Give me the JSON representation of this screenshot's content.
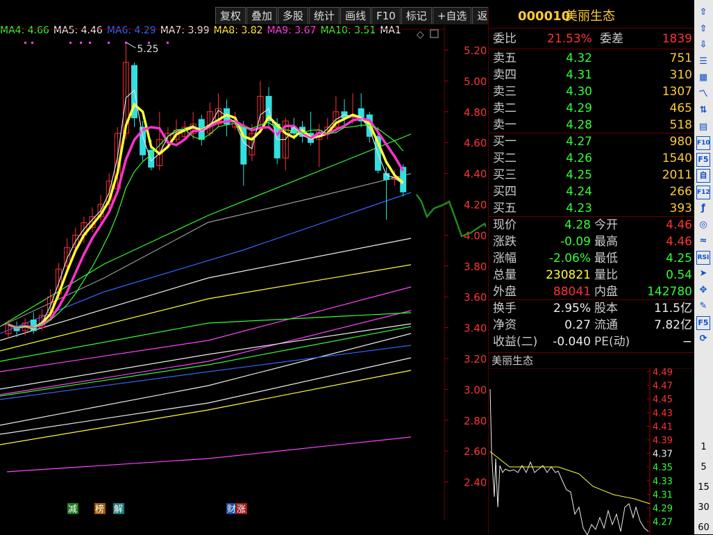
{
  "toolbar": {
    "items": [
      "复权",
      "叠加",
      "多股",
      "统计",
      "画线",
      "F10",
      "标记",
      "+自选",
      "返回"
    ]
  },
  "stock": {
    "code": "000010",
    "name": "美丽生态"
  },
  "ma_legend": [
    {
      "label": "MA4: 4.66",
      "color": "#33ff33"
    },
    {
      "label": "MA5: 4.46",
      "color": "#eeeeee"
    },
    {
      "label": "MA6: 4.29",
      "color": "#3366ff"
    },
    {
      "label": "MA7: 3.99",
      "color": "#eeeeee"
    },
    {
      "label": "MA8: 3.82",
      "color": "#ffff33"
    },
    {
      "label": "MA9: 3.67",
      "color": "#ff44ff"
    },
    {
      "label": "MA10: 3.51",
      "color": "#33ff33"
    },
    {
      "label": "MA1",
      "color": "#eeeeee"
    }
  ],
  "chart_data": {
    "type": "candlestick",
    "ylim": [
      2.3,
      5.3
    ],
    "y_ticks": [
      "5.20",
      "5.00",
      "4.80",
      "4.60",
      "4.40",
      "4.20",
      "4.00",
      "3.80",
      "3.60",
      "3.40",
      "3.20",
      "3.00",
      "2.80",
      "2.60",
      "2.40"
    ],
    "high_annotation": "5.25",
    "markers": [
      {
        "text": "减",
        "bg": "#1b7a1b"
      },
      {
        "text": "榜",
        "bg": "#a05a00"
      },
      {
        "text": "解",
        "bg": "#1b7a7a"
      },
      {
        "text": "财",
        "bg": "#1b4a9a"
      },
      {
        "text": "涨",
        "bg": "#a01b1b"
      }
    ],
    "candles": [
      {
        "o": 3.36,
        "c": 3.42,
        "h": 3.45,
        "l": 3.33
      },
      {
        "o": 3.4,
        "c": 3.38,
        "h": 3.44,
        "l": 3.34
      },
      {
        "o": 3.38,
        "c": 3.43,
        "h": 3.46,
        "l": 3.35
      },
      {
        "o": 3.45,
        "c": 3.38,
        "h": 3.5,
        "l": 3.36
      },
      {
        "o": 3.4,
        "c": 3.48,
        "h": 3.52,
        "l": 3.38
      },
      {
        "o": 3.5,
        "c": 3.6,
        "h": 3.65,
        "l": 3.46
      },
      {
        "o": 3.62,
        "c": 3.78,
        "h": 3.82,
        "l": 3.58
      },
      {
        "o": 3.8,
        "c": 3.92,
        "h": 3.98,
        "l": 3.75
      },
      {
        "o": 3.92,
        "c": 4.0,
        "h": 4.05,
        "l": 3.88
      },
      {
        "o": 4.0,
        "c": 4.08,
        "h": 4.12,
        "l": 3.95
      },
      {
        "o": 4.05,
        "c": 4.12,
        "h": 4.18,
        "l": 4.02
      },
      {
        "o": 4.12,
        "c": 4.2,
        "h": 4.26,
        "l": 4.08
      },
      {
        "o": 4.2,
        "c": 4.35,
        "h": 4.4,
        "l": 4.16
      },
      {
        "o": 4.3,
        "c": 4.66,
        "h": 4.7,
        "l": 4.28
      },
      {
        "o": 4.66,
        "c": 5.12,
        "h": 5.25,
        "l": 4.62
      },
      {
        "o": 5.1,
        "c": 4.76,
        "h": 5.12,
        "l": 4.7
      },
      {
        "o": 4.7,
        "c": 4.52,
        "h": 4.74,
        "l": 4.48
      },
      {
        "o": 4.55,
        "c": 4.44,
        "h": 4.62,
        "l": 4.42
      },
      {
        "o": 4.45,
        "c": 4.62,
        "h": 4.8,
        "l": 4.42
      },
      {
        "o": 4.6,
        "c": 4.66,
        "h": 4.7,
        "l": 4.56
      },
      {
        "o": 4.62,
        "c": 4.68,
        "h": 4.75,
        "l": 4.6
      },
      {
        "o": 4.64,
        "c": 4.7,
        "h": 4.74,
        "l": 4.62
      },
      {
        "o": 4.66,
        "c": 4.72,
        "h": 4.8,
        "l": 4.62
      },
      {
        "o": 4.75,
        "c": 4.62,
        "h": 4.78,
        "l": 4.58
      },
      {
        "o": 4.66,
        "c": 4.8,
        "h": 4.86,
        "l": 4.64
      },
      {
        "o": 4.72,
        "c": 4.82,
        "h": 4.92,
        "l": 4.7
      },
      {
        "o": 4.82,
        "c": 4.72,
        "h": 4.88,
        "l": 4.64
      },
      {
        "o": 4.7,
        "c": 4.74,
        "h": 4.8,
        "l": 4.68
      },
      {
        "o": 4.7,
        "c": 4.46,
        "h": 4.74,
        "l": 4.32
      },
      {
        "o": 4.52,
        "c": 4.66,
        "h": 4.72,
        "l": 4.48
      },
      {
        "o": 4.7,
        "c": 4.9,
        "h": 5.0,
        "l": 4.66
      },
      {
        "o": 4.9,
        "c": 4.74,
        "h": 4.96,
        "l": 4.7
      },
      {
        "o": 4.72,
        "c": 4.5,
        "h": 4.76,
        "l": 4.46
      },
      {
        "o": 4.5,
        "c": 4.74,
        "h": 4.76,
        "l": 4.42
      },
      {
        "o": 4.7,
        "c": 4.66,
        "h": 4.76,
        "l": 4.62
      },
      {
        "o": 4.7,
        "c": 4.64,
        "h": 4.74,
        "l": 4.6
      },
      {
        "o": 4.66,
        "c": 4.6,
        "h": 4.8,
        "l": 4.58
      },
      {
        "o": 4.62,
        "c": 4.68,
        "h": 4.72,
        "l": 4.44
      },
      {
        "o": 4.66,
        "c": 4.7,
        "h": 4.76,
        "l": 4.62
      },
      {
        "o": 4.7,
        "c": 4.8,
        "h": 4.9,
        "l": 4.66
      },
      {
        "o": 4.8,
        "c": 4.76,
        "h": 4.88,
        "l": 4.7
      },
      {
        "o": 4.76,
        "c": 4.78,
        "h": 4.92,
        "l": 4.72
      },
      {
        "o": 4.82,
        "c": 4.74,
        "h": 4.92,
        "l": 4.7
      },
      {
        "o": 4.78,
        "c": 4.64,
        "h": 4.8,
        "l": 4.6
      },
      {
        "o": 4.64,
        "c": 4.42,
        "h": 4.7,
        "l": 4.4
      },
      {
        "o": 4.4,
        "c": 4.36,
        "h": 4.44,
        "l": 4.1
      },
      {
        "o": 4.36,
        "c": 4.38,
        "h": 4.42,
        "l": 4.32
      },
      {
        "o": 4.44,
        "c": 4.28,
        "h": 4.46,
        "l": 4.25
      }
    ]
  },
  "quote": {
    "weibi_label": "委比",
    "weibi": "21.53%",
    "weicha_label": "委差",
    "weicha": "1839",
    "sell": [
      {
        "label": "卖五",
        "price": "4.32",
        "vol": "751"
      },
      {
        "label": "卖四",
        "price": "4.31",
        "vol": "310"
      },
      {
        "label": "卖三",
        "price": "4.30",
        "vol": "1307"
      },
      {
        "label": "卖二",
        "price": "4.29",
        "vol": "465"
      },
      {
        "label": "卖一",
        "price": "4.28",
        "vol": "518"
      }
    ],
    "buy": [
      {
        "label": "买一",
        "price": "4.27",
        "vol": "980"
      },
      {
        "label": "买二",
        "price": "4.26",
        "vol": "1540"
      },
      {
        "label": "买三",
        "price": "4.25",
        "vol": "2011"
      },
      {
        "label": "买四",
        "price": "4.24",
        "vol": "266"
      },
      {
        "label": "买五",
        "price": "4.23",
        "vol": "393"
      }
    ],
    "stats": [
      {
        "l1": "现价",
        "v1": "4.28",
        "c1": "green",
        "l2": "今开",
        "v2": "4.46",
        "c2": "red"
      },
      {
        "l1": "涨跌",
        "v1": "-0.09",
        "c1": "green",
        "l2": "最高",
        "v2": "4.46",
        "c2": "red"
      },
      {
        "l1": "涨幅",
        "v1": "-2.06%",
        "c1": "green",
        "l2": "最低",
        "v2": "4.25",
        "c2": "green"
      },
      {
        "l1": "总量",
        "v1": "230821",
        "c1": "yellow",
        "l2": "量比",
        "v2": "0.54",
        "c2": "green"
      },
      {
        "l1": "外盘",
        "v1": "88041",
        "c1": "red",
        "l2": "内盘",
        "v2": "142780",
        "c2": "green"
      }
    ],
    "stats2": [
      {
        "l1": "换手",
        "v1": "2.95%",
        "l2": "股本",
        "v2": "11.5亿"
      },
      {
        "l1": "净资",
        "v1": "0.27",
        "l2": "流通",
        "v2": "7.82亿"
      },
      {
        "l1": "收益(二)",
        "v1": "-0.040",
        "l2": "PE(动)",
        "v2": "−"
      }
    ]
  },
  "mini": {
    "title": "美丽生态",
    "ticks": [
      "4.49",
      "4.47",
      "4.45",
      "4.43",
      "4.41",
      "4.39",
      "4.37",
      "4.35",
      "4.33",
      "4.31",
      "4.29",
      "4.27"
    ]
  },
  "right_toolbar": {
    "icons": [
      "up-arrow-icon",
      "up-outline-arrow-icon",
      "down-outline-arrow-icon",
      "list-icon",
      "grid-icon",
      "line-chart-icon",
      "candle-icon",
      "table-icon",
      "f10-icon",
      "f5-icon",
      "self-select-icon",
      "f12-icon",
      "formula-icon",
      "circle-icon",
      "wave-icon",
      "rsi-icon",
      "cursor-icon",
      "move-icon",
      "pencil-icon",
      "f5b-icon",
      "refresh-icon"
    ],
    "labels": {
      "f10-icon": "F10",
      "f5-icon": "F5",
      "self-select-icon": "自",
      "f12-icon": "F12",
      "rsi-icon": "RSI",
      "f5b-icon": "F5"
    },
    "periods": [
      "1",
      "5",
      "15",
      "30",
      "60"
    ]
  }
}
